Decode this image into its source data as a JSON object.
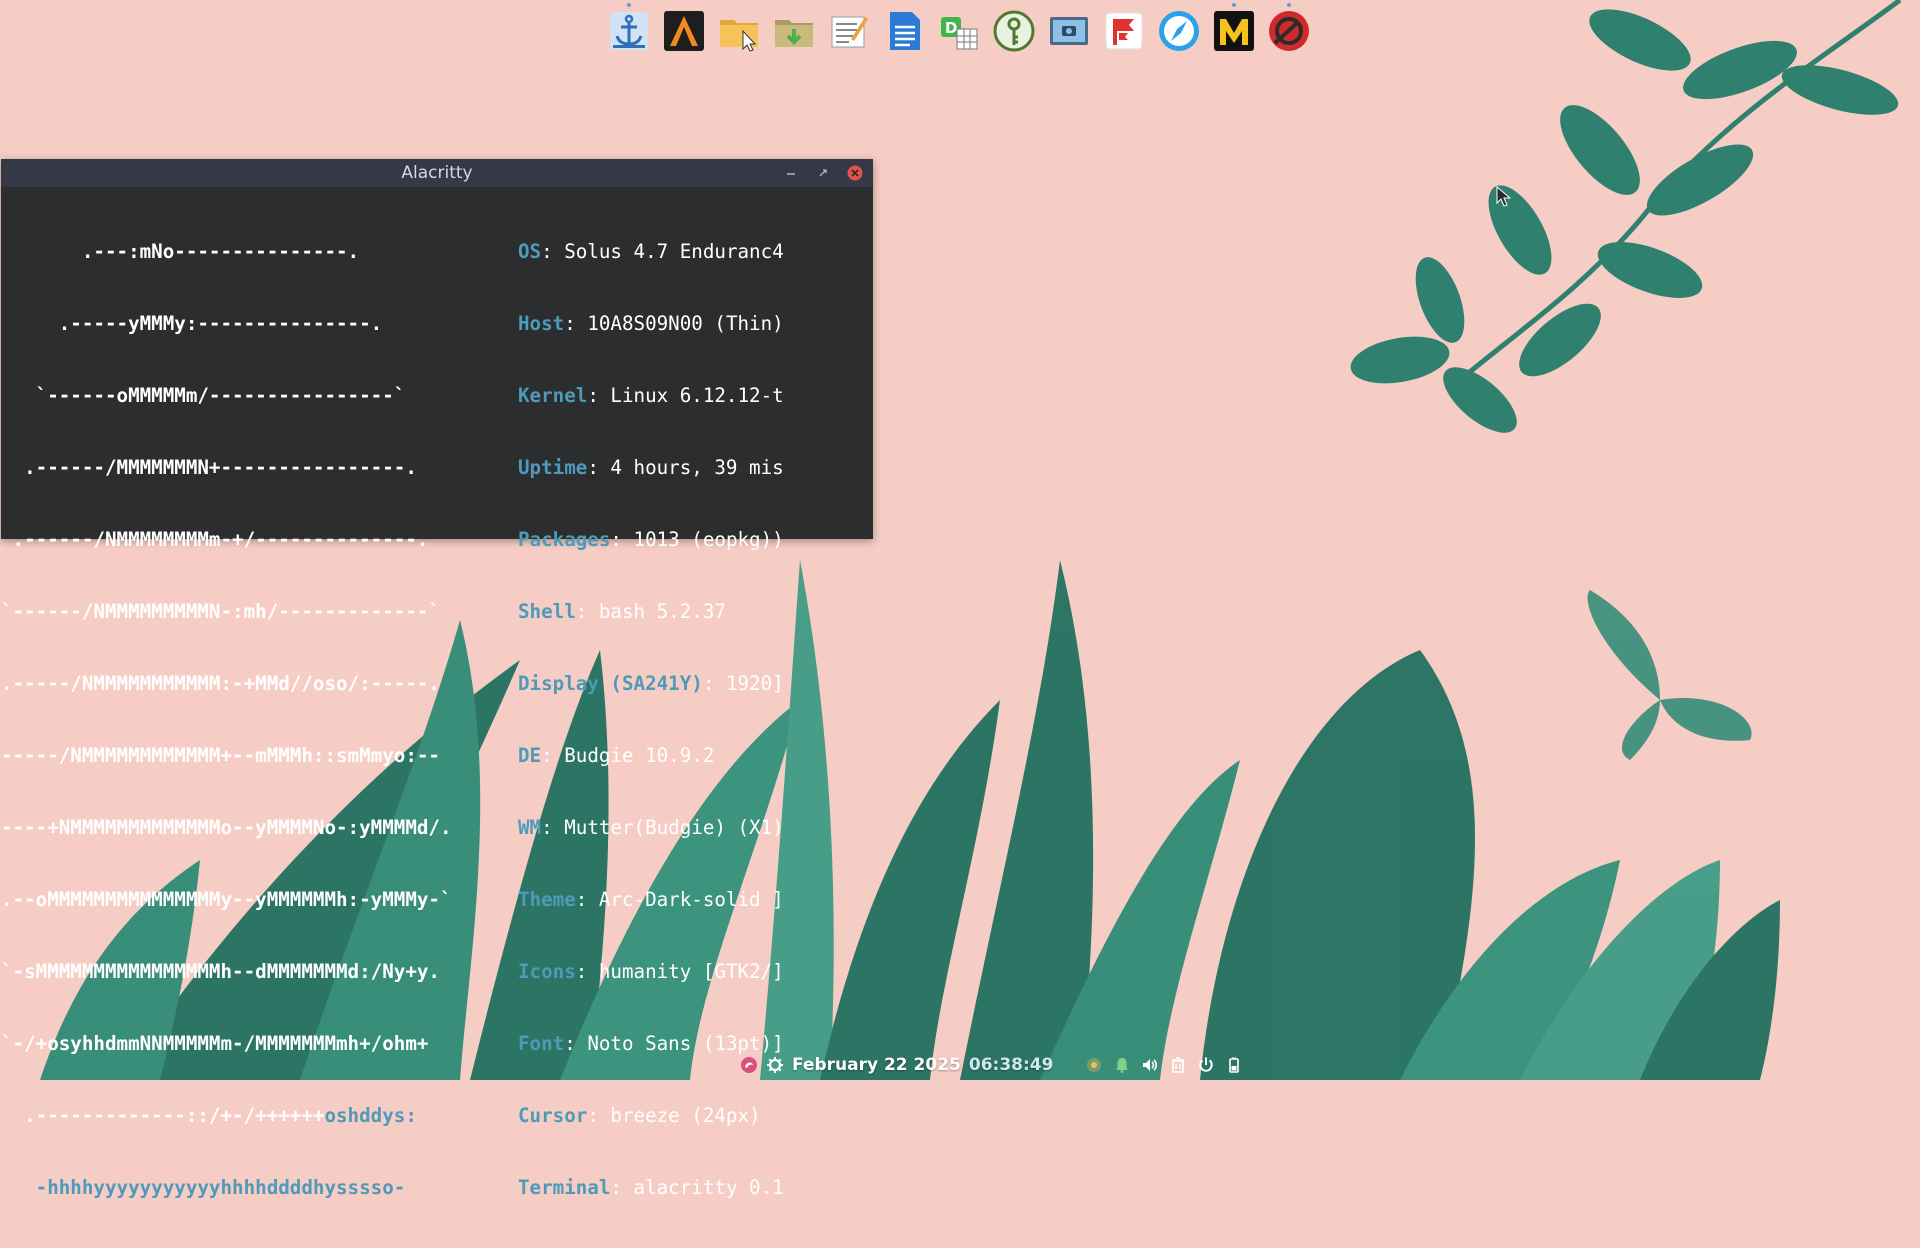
{
  "window": {
    "title": "Alacritty"
  },
  "dock": {
    "items": [
      {
        "icon": "anchor-icon",
        "running": true
      },
      {
        "icon": "arch-a-icon",
        "running": false
      },
      {
        "icon": "folder-cursor-icon",
        "running": false
      },
      {
        "icon": "folder-download-icon",
        "running": false
      },
      {
        "icon": "text-editor-icon",
        "running": false
      },
      {
        "icon": "document-writer-icon",
        "running": false
      },
      {
        "icon": "spreadsheet-icon",
        "running": false
      },
      {
        "icon": "keepass-icon",
        "running": false
      },
      {
        "icon": "screenshot-icon",
        "running": false
      },
      {
        "icon": "flag-app-icon",
        "running": false
      },
      {
        "icon": "compass-browser-icon",
        "running": false
      },
      {
        "icon": "m-app-icon",
        "running": true
      },
      {
        "icon": "red-circle-app-icon",
        "running": true
      }
    ]
  },
  "terminal": {
    "logo_lines": [
      "       .---:mNo---------------.",
      "     .-----yMMMy:---------------.",
      "   `------oMMMMMm/----------------`",
      "  .------/MMMMMMMN+----------------.",
      " .------/NMMMMMMMMm-+/--------------.",
      "`------/NMMMMMMMMMN-:mh/-------------`",
      ".-----/NMMMMMMMMMMM:-+MMd//oso/:-----.",
      "-----/NMMMMMMMMMMMM+--mMMMh::smMmyo:--",
      "----+NMMMMMMMMMMMMMo--yMMMMNo-:yMMMMd/.",
      ".--oMMMMMMMMMMMMMMMy--yMMMMMMh:-yMMMy-`",
      "`-sMMMMMMMMMMMMMMMMh--dMMMMMMMd:/Ny+y.",
      "`-/+osyhhdmmNNMMMMMm-/MMMMMMMmh+/ohm+",
      "  .-------------::/+-/++++++",
      "   -hhhhyyyyyyyyyyyhhhhddddhysssso-"
    ],
    "logo_accent_tail": "oshddys:",
    "info": [
      {
        "key": "OS",
        "value": ": Solus 4.7 Enduranc4"
      },
      {
        "key": "Host",
        "value": ": 10A8S09N00 (Thin)"
      },
      {
        "key": "Kernel",
        "value": ": Linux 6.12.12-t"
      },
      {
        "key": "Uptime",
        "value": ": 4 hours, 39 mis"
      },
      {
        "key": "Packages",
        "value": ": 1013 (eopkg))"
      },
      {
        "key": "Shell",
        "value": ": bash 5.2.37"
      },
      {
        "key": "Display (SA241Y)",
        "value": ": 1920]"
      },
      {
        "key": "DE",
        "value": ": Budgie 10.9.2"
      },
      {
        "key": "WM",
        "value": ": Mutter(Budgie) (X1)"
      },
      {
        "key": "Theme",
        "value": ": Arc-Dark-solid ]"
      },
      {
        "key": "Icons",
        "value": ": humanity [GTK2/]"
      },
      {
        "key": "Font",
        "value": ": Noto Sans (13pt)]"
      },
      {
        "key": "Cursor",
        "value": ": breeze (24px)"
      },
      {
        "key": "Terminal",
        "value": ": alacritty 0.1"
      }
    ]
  },
  "panel": {
    "date": "February 22 2025",
    "time": "06:38:49"
  },
  "colors": {
    "accent": "#4e9ab8",
    "background": "#f6cdc4",
    "leaf": "#1f7a68",
    "close": "#e2534b"
  }
}
